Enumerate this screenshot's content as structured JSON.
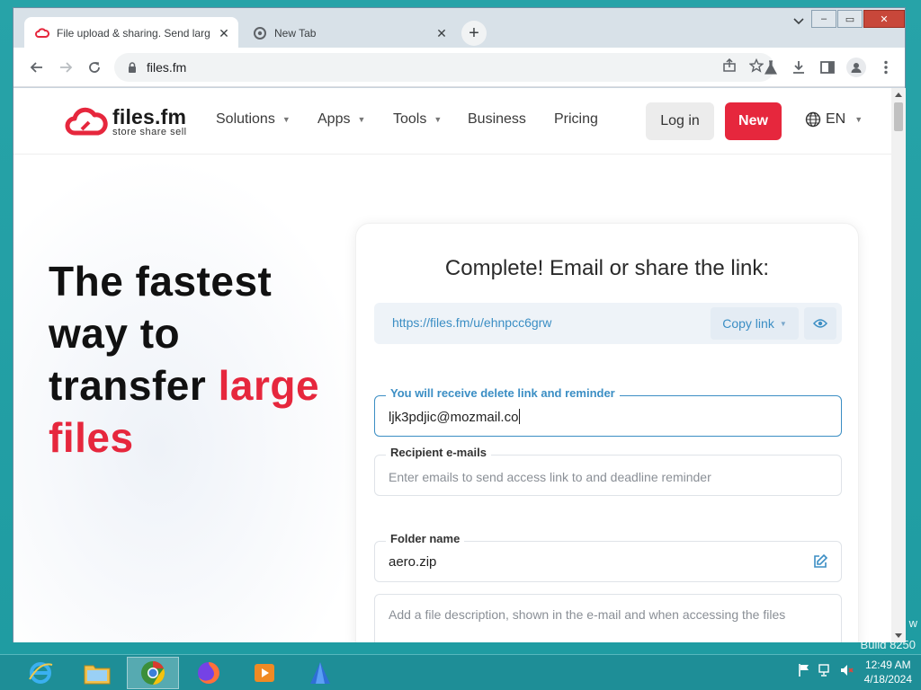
{
  "desktop": {
    "watermark_line1": "w",
    "watermark_line2": "Build 8250"
  },
  "browser": {
    "tabs": [
      {
        "title": "File upload & sharing. Send larg",
        "favicon": "files-fm-logo-icon",
        "active": true
      },
      {
        "title": "New Tab",
        "favicon": "chrome-icon",
        "active": false
      }
    ],
    "new_tab_label": "+",
    "address": "files.fm",
    "window_buttons": {
      "minimize": "–",
      "restore": "▭",
      "close": "✕"
    }
  },
  "site": {
    "logo": {
      "name": "files.fm",
      "tagline": "store  share  sell"
    },
    "nav": [
      {
        "label": "Solutions",
        "has_caret": true
      },
      {
        "label": "Apps",
        "has_caret": true
      },
      {
        "label": "Tools",
        "has_caret": true
      },
      {
        "label": "Business",
        "has_caret": false
      },
      {
        "label": "Pricing",
        "has_caret": false
      }
    ],
    "login_label": "Log in",
    "new_label": "New",
    "language": "EN",
    "brand_color": "#e6273d",
    "accent_color": "#3b8ec4"
  },
  "hero": {
    "line1": "The fastest",
    "line2": "way to",
    "line3_plain": "transfer ",
    "line3_red": "large",
    "line4_red": "files"
  },
  "card": {
    "title": "Complete! Email or share the link:",
    "share_link": "https://files.fm/u/ehnpcc6grw",
    "copy_label": "Copy link",
    "email_field": {
      "label": "You will receive delete link and reminder",
      "value": "ljk3pdjic@mozmail.co"
    },
    "recipient_field": {
      "label": "Recipient e-mails",
      "placeholder": "Enter emails to send access link to and deadline reminder"
    },
    "folder_field": {
      "label": "Folder name",
      "value": "aero.zip"
    },
    "description_field": {
      "placeholder": "Add a file description, shown in the e-mail and when accessing the files"
    }
  },
  "taskbar": {
    "apps": [
      "internet-explorer-icon",
      "file-explorer-icon",
      "chrome-icon",
      "firefox-icon",
      "media-player-icon",
      "app-icon"
    ],
    "time": "12:49 AM",
    "date": "4/18/2024"
  }
}
